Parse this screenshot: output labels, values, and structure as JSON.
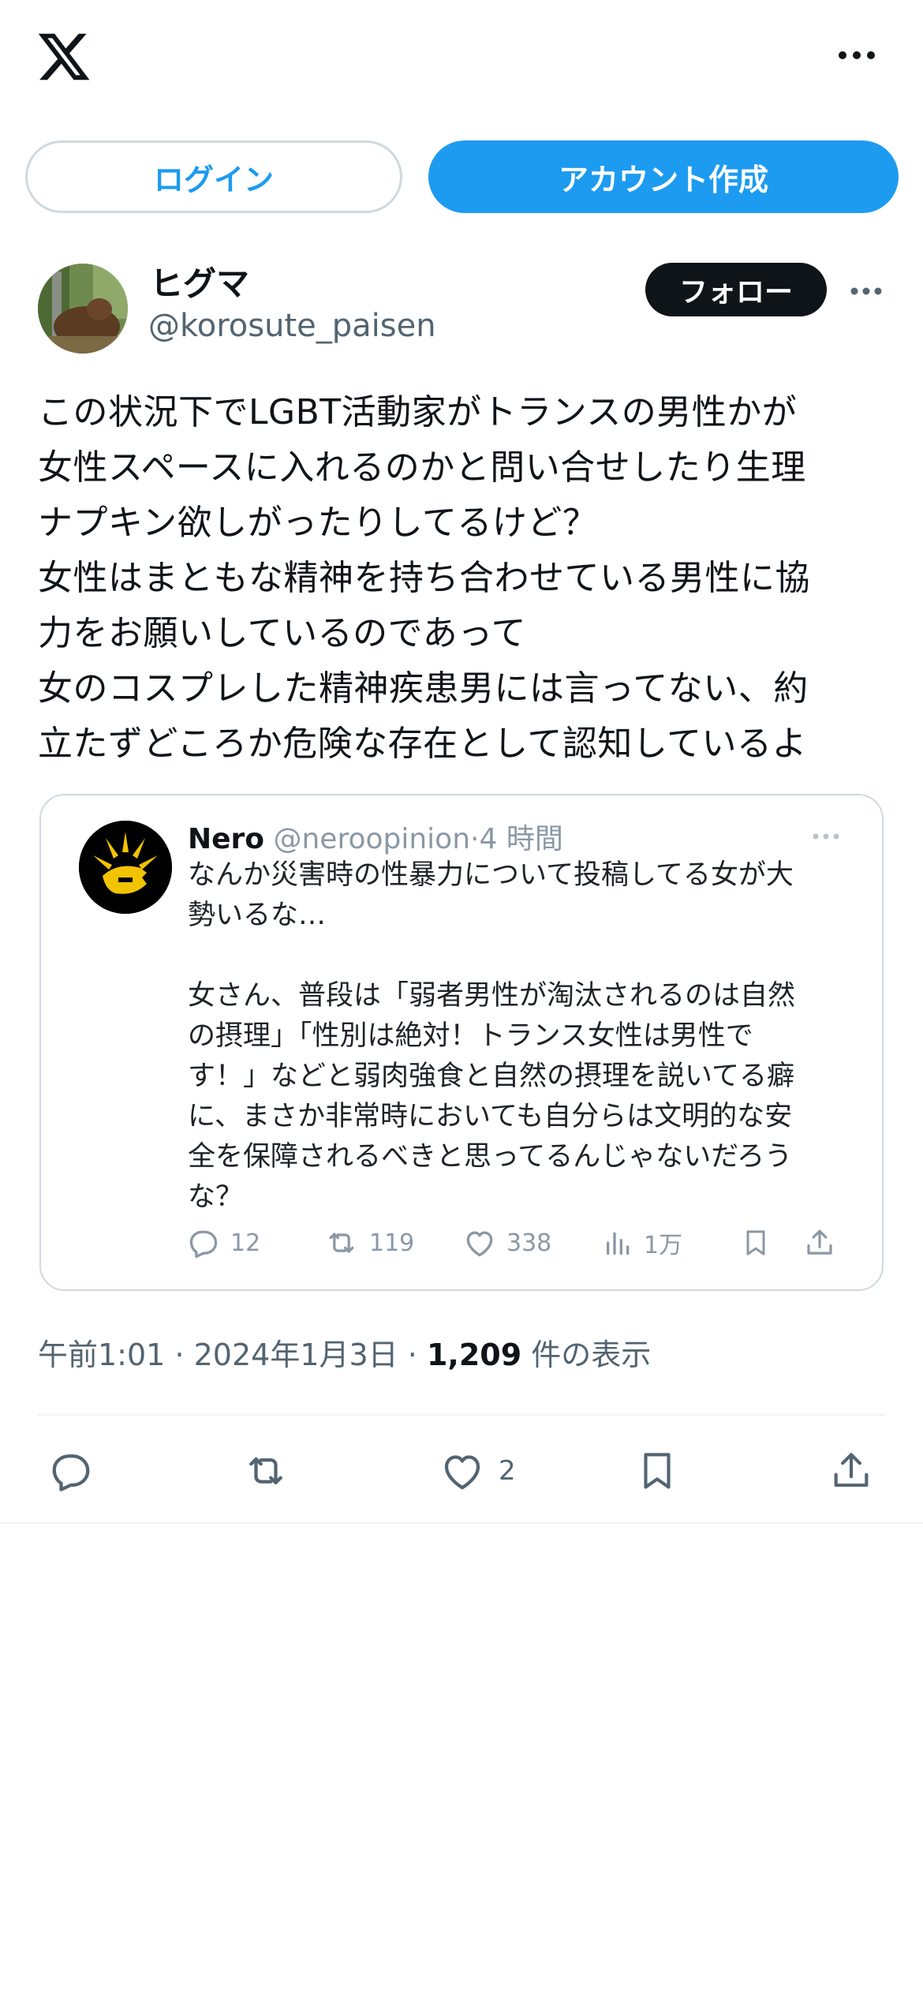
{
  "topbar": {
    "login_label": "ログイン",
    "signup_label": "アカウント作成"
  },
  "tweet": {
    "author_name": "ヒグマ",
    "author_handle": "@korosute_paisen",
    "follow_label": "フォロー",
    "text": "この状況下でLGBT活動家がトランスの男性かが\n女性スペースに入れるのかと問い合せしたり生理\nナプキン欲しがったりしてるけど？\n女性はまともな精神を持ち合わせている男性に協\n力をお願いしているのであって\n女のコスプレした精神疾患男には言ってない、約\n立たずどころか危険な存在として認知しているよ",
    "time": "午前1:01",
    "date": "2024年1月3日",
    "views_count": "1,209",
    "views_label": "件の表示",
    "separator": "·",
    "likes_count": "2"
  },
  "quote": {
    "name": "Nero",
    "handle": "@neroopinion",
    "separator": "·",
    "time": "4 時間",
    "text": "なんか災害時の性暴力について投稿してる女が大\n勢いるな…\n\n女さん、普段は「弱者男性が淘汰されるのは自然\nの摂理」「性別は絶対！トランス女性は男性で\nす！」などと弱肉強食と自然の摂理を説いてる癖\nに、まさか非常時においても自分らは文明的な安\n全を保障されるべきと思ってるんじゃないだろう\nな？",
    "replies": "12",
    "retweets": "119",
    "likes": "338",
    "views": "1万"
  },
  "colors": {
    "accent": "#1d9bf0",
    "text": "#0f1419",
    "secondary": "#536471",
    "border": "#cfd9de"
  },
  "icons": [
    "x-logo-icon",
    "more-icon",
    "reply-icon",
    "retweet-icon",
    "like-icon",
    "views-icon",
    "bookmark-icon",
    "share-icon"
  ]
}
